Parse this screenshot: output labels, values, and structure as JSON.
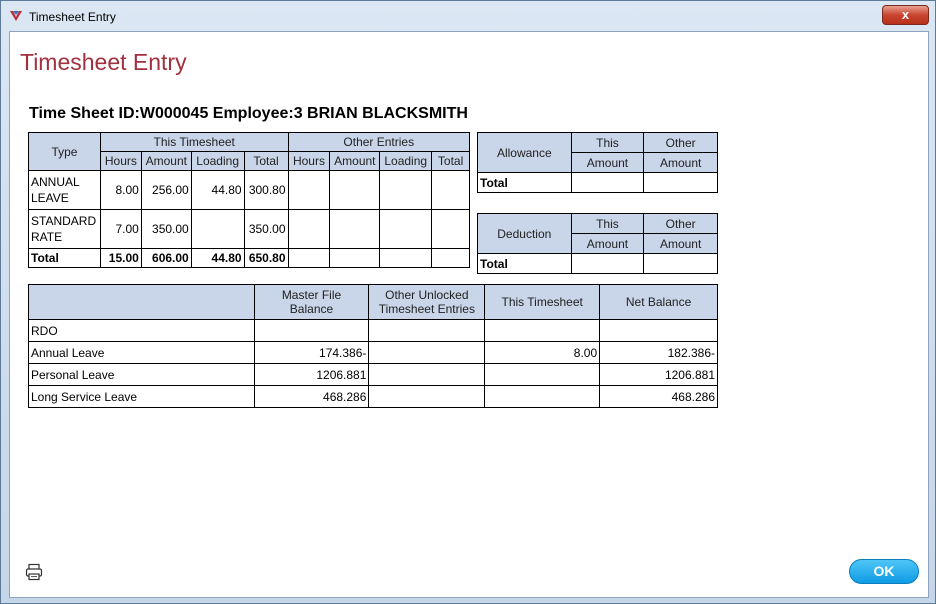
{
  "window": {
    "title": "Timesheet Entry"
  },
  "close_label": "x",
  "page_title": "Timesheet Entry",
  "heading": "Time Sheet ID:W000045 Employee:3 BRIAN BLACKSMITH",
  "timesheet_table": {
    "col_type": "Type",
    "group_this": "This Timesheet",
    "group_other": "Other Entries",
    "sub_cols": [
      "Hours",
      "Amount",
      "Loading",
      "Total",
      "Hours",
      "Amount",
      "Loading",
      "Total"
    ],
    "rows": [
      {
        "type": [
          "ANNUAL",
          "LEAVE"
        ],
        "hours": "8.00",
        "amount": "256.00",
        "loading": "44.80",
        "total": "300.80"
      },
      {
        "type": [
          "STANDARD",
          "RATE"
        ],
        "hours": "7.00",
        "amount": "350.00",
        "loading": "",
        "total": "350.00"
      }
    ],
    "total_row": {
      "label": "Total",
      "hours": "15.00",
      "amount": "606.00",
      "loading": "44.80",
      "total": "650.80"
    }
  },
  "allowance_table": {
    "label": "Allowance",
    "this_top": "This",
    "this_bottom": "Amount",
    "other_top": "Other",
    "other_bottom": "Amount",
    "total": "Total"
  },
  "deduction_table": {
    "label": "Deduction",
    "this_top": "This",
    "this_bottom": "Amount",
    "other_top": "Other",
    "other_bottom": "Amount",
    "total": "Total"
  },
  "balance_table": {
    "headers": [
      [
        "Master File",
        "Balance"
      ],
      [
        "Other Unlocked",
        "Timesheet Entries"
      ],
      [
        "This Timesheet"
      ],
      [
        "Net Balance"
      ]
    ],
    "rows": [
      {
        "label": "RDO",
        "master": "",
        "other": "",
        "this": "",
        "net": ""
      },
      {
        "label": "Annual Leave",
        "master": "174.386-",
        "other": "",
        "this": "8.00",
        "net": "182.386-"
      },
      {
        "label": "Personal Leave",
        "master": "1206.881",
        "other": "",
        "this": "",
        "net": "1206.881"
      },
      {
        "label": "Long Service Leave",
        "master": "468.286",
        "other": "",
        "this": "",
        "net": "468.286"
      }
    ]
  },
  "icons": {
    "app": "app-logo-icon",
    "print": "printer-icon"
  },
  "colors": {
    "title": "#a3303e",
    "header_fill": "#c9d5e8",
    "ok_button": "#1aa6ec"
  },
  "ok_label": "OK"
}
